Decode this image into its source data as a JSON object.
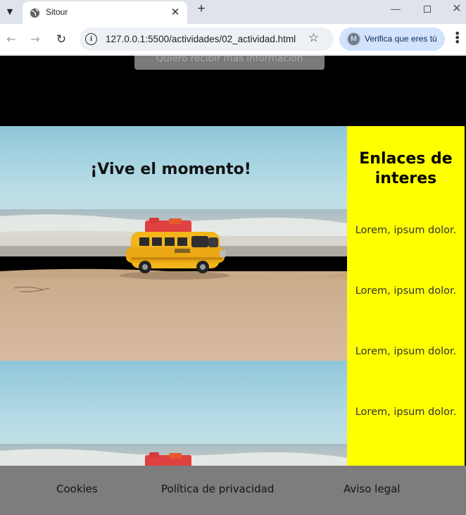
{
  "browser": {
    "tab_title": "Sitour",
    "url": "127.0.0.1:5500/actividades/02_actividad.html",
    "profile_chip_label": "Verifica que eres tú",
    "profile_initial": "M"
  },
  "page": {
    "info_button_label": "Quiero recibir más información",
    "hero_title": "¡Vive el momento!",
    "aside": {
      "title": "Enlaces de interes",
      "links": [
        "Lorem, ipsum dolor.",
        "Lorem, ipsum dolor.",
        "Lorem, ipsum dolor.",
        "Lorem, ipsum dolor."
      ]
    },
    "footer_links": [
      "Cookies",
      "Política de privacidad",
      "Aviso legal"
    ]
  },
  "colors": {
    "aside_background": "#ffff00",
    "footer_background": "#7d7d7d",
    "header_background": "#000000"
  }
}
